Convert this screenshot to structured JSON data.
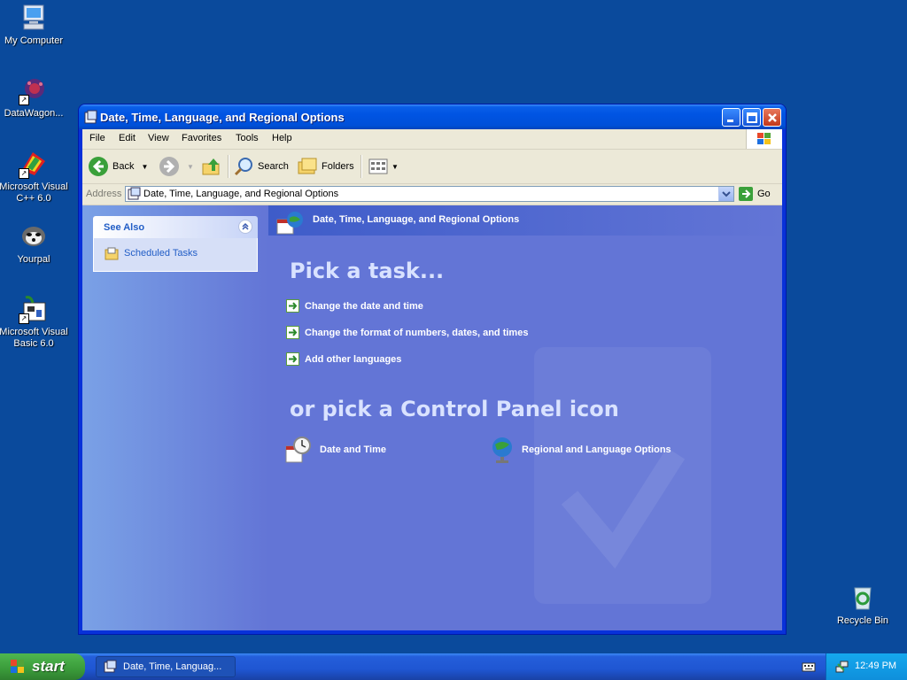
{
  "desktop": {
    "icons": [
      {
        "label": "My Computer"
      },
      {
        "label": "DataWagon..."
      },
      {
        "label": "Microsoft Visual C++ 6.0"
      },
      {
        "label": "Yourpal"
      },
      {
        "label": "Microsoft Visual Basic 6.0"
      },
      {
        "label": "Recycle Bin"
      }
    ]
  },
  "window": {
    "title": "Date, Time, Language, and Regional Options",
    "menu": [
      "File",
      "Edit",
      "View",
      "Favorites",
      "Tools",
      "Help"
    ],
    "toolbar": {
      "back": "Back",
      "search": "Search",
      "folders": "Folders"
    },
    "address": {
      "label": "Address",
      "value": "Date, Time, Language, and Regional Options",
      "go": "Go"
    },
    "see_also": {
      "heading": "See Also",
      "items": [
        "Scheduled Tasks"
      ]
    },
    "header": "Date, Time, Language, and Regional Options",
    "pick_task": "Pick a task...",
    "tasks": [
      "Change the date and time",
      "Change the format of numbers, dates, and times",
      "Add other languages"
    ],
    "pick_icon": "or pick a Control Panel icon",
    "cp_icons": [
      "Date and Time",
      "Regional and Language Options"
    ]
  },
  "taskbar": {
    "start": "start",
    "task_button": "Date, Time, Languag...",
    "clock": "12:49 PM"
  }
}
